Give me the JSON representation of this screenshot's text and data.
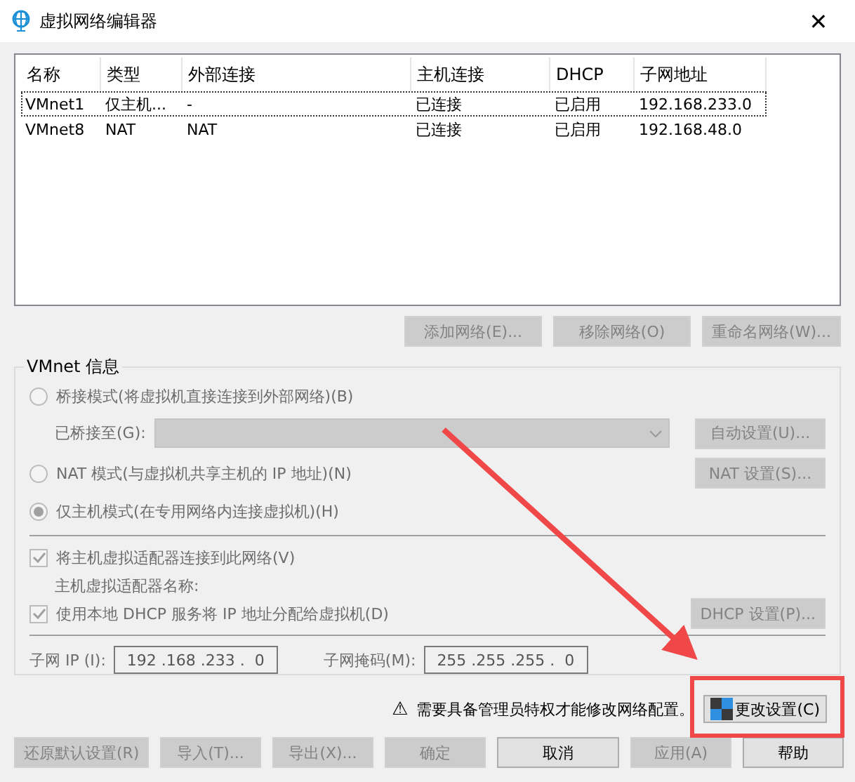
{
  "window": {
    "title": "虚拟网络编辑器",
    "close": "✕"
  },
  "table": {
    "columns": [
      "名称",
      "类型",
      "外部连接",
      "主机连接",
      "DHCP",
      "子网地址"
    ],
    "rows": [
      {
        "cells": [
          "VMnet1",
          "仅主机...",
          "-",
          "已连接",
          "已启用",
          "192.168.233.0"
        ],
        "selected": true
      },
      {
        "cells": [
          "VMnet8",
          "NAT",
          "NAT",
          "已连接",
          "已启用",
          "192.168.48.0"
        ],
        "selected": false
      }
    ]
  },
  "list_buttons": [
    {
      "label": "添加网络(E)...",
      "disabled": true
    },
    {
      "label": "移除网络(O)",
      "disabled": true
    },
    {
      "label": "重命名网络(W)...",
      "disabled": true
    }
  ],
  "vmnet_info": {
    "title": "VMnet 信息",
    "bridged": {
      "label": "桥接模式(将虚拟机直接连接到外部网络)(B)",
      "selected": false,
      "disabled": true
    },
    "bridged_to": {
      "label": "已桥接至(G):",
      "disabled": true,
      "button": {
        "label": "自动设置(U)...",
        "disabled": true
      }
    },
    "nat": {
      "label": "NAT 模式(与虚拟机共享主机的 IP 地址)(N)",
      "selected": false,
      "disabled": true,
      "button": {
        "label": "NAT 设置(S)...",
        "disabled": true
      }
    },
    "host_only": {
      "label": "仅主机模式(在专用网络内连接虚拟机)(H)",
      "selected": true,
      "disabled": true
    },
    "connect_adapter": {
      "label": "将主机虚拟适配器连接到此网络(V)",
      "checked": true,
      "disabled": true
    },
    "adapter_name": {
      "label": "主机虚拟适配器名称:"
    },
    "use_dhcp": {
      "label": "使用本地 DHCP 服务将 IP 地址分配给虚拟机(D)",
      "checked": true,
      "disabled": true,
      "button": {
        "label": "DHCP 设置(P)...",
        "disabled": true
      }
    },
    "subnet_ip": {
      "label": "子网 IP (I):",
      "value": "192 .168 .233 .  0"
    },
    "subnet_mask": {
      "label": "子网掩码(M):",
      "value": "255 .255 .255 .  0"
    }
  },
  "admin_notice": {
    "icon": "⚠",
    "text": "需要具备管理员特权才能修改网络配置。",
    "button": {
      "label": "更改设置(C)",
      "disabled": false
    }
  },
  "footer_buttons": [
    {
      "label": "还原默认设置(R)",
      "disabled": true
    },
    {
      "label": "导入(T)...",
      "disabled": true
    },
    {
      "label": "导出(X)...",
      "disabled": true
    },
    {
      "label": "确定",
      "disabled": true
    },
    {
      "label": "取消",
      "disabled": false
    },
    {
      "label": "应用(A)",
      "disabled": true
    },
    {
      "label": "帮助",
      "disabled": false
    }
  ]
}
